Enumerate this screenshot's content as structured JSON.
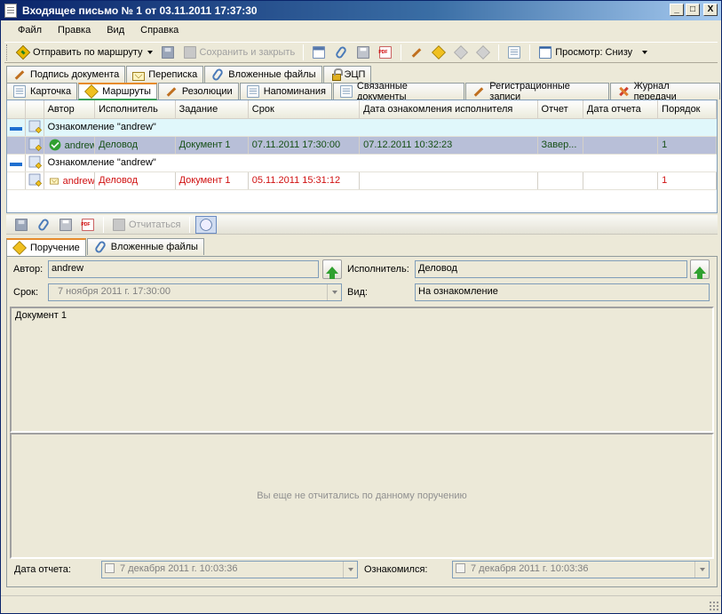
{
  "window": {
    "title": "Входящее письмо № 1 от 03.11.2011 17:37:30",
    "buttons": {
      "minimize": "_",
      "maximize": "□",
      "close": "X"
    }
  },
  "menu": [
    "Файл",
    "Правка",
    "Вид",
    "Справка"
  ],
  "toolbar": {
    "send_route": "Отправить по маршруту",
    "save_close": "Сохранить и закрыть",
    "view_label": "Просмотр: Снизу"
  },
  "tabs_top": [
    "Подпись документа",
    "Переписка",
    "Вложенные файлы",
    "ЭЦП"
  ],
  "tabs_main": [
    "Карточка",
    "Маршруты",
    "Резолюции",
    "Напоминания",
    "Связанные документы",
    "Регистрационные записи",
    "Журнал передачи"
  ],
  "grid": {
    "columns": [
      "Автор",
      "Исполнитель",
      "Задание",
      "Срок",
      "Дата ознакомления исполнителя",
      "Отчет",
      "Дата отчета",
      "Порядок"
    ],
    "groups": [
      {
        "label": "Ознакомление \"andrew\"",
        "row": {
          "author": "andrew",
          "executor": "Деловод",
          "task": "Документ 1",
          "deadline": "07.11.2011 17:30:00",
          "read_date": "07.12.2011 10:32:23",
          "report": "Завер...",
          "report_date": "",
          "order": "1"
        }
      },
      {
        "label": "Ознакомление \"andrew\"",
        "row": {
          "author": "andrew",
          "executor": "Деловод",
          "task": "Документ 1",
          "deadline": "05.11.2011 15:31:12",
          "read_date": "",
          "report": "",
          "report_date": "",
          "order": "1"
        }
      }
    ]
  },
  "toolbar2": {
    "report_label": "Отчитаться"
  },
  "tabs_detail": [
    "Поручение",
    "Вложенные файлы"
  ],
  "detail": {
    "author_label": "Автор:",
    "author_value": "andrew",
    "executor_label": "Исполнитель:",
    "executor_value": "Деловод",
    "deadline_label": "Срок:",
    "deadline_value": "7  ноября  2011 г. 17:30:00",
    "kind_label": "Вид:",
    "kind_value": "На ознакомление",
    "task_text": "Документ 1",
    "empty_report": "Вы еще не отчитались по данному поручению",
    "report_date_label": "Дата отчета:",
    "report_date_value": "7  декабря  2011 г. 10:03:36",
    "read_label": "Ознакомился:",
    "read_value": "7  декабря  2011 г. 10:03:36"
  }
}
